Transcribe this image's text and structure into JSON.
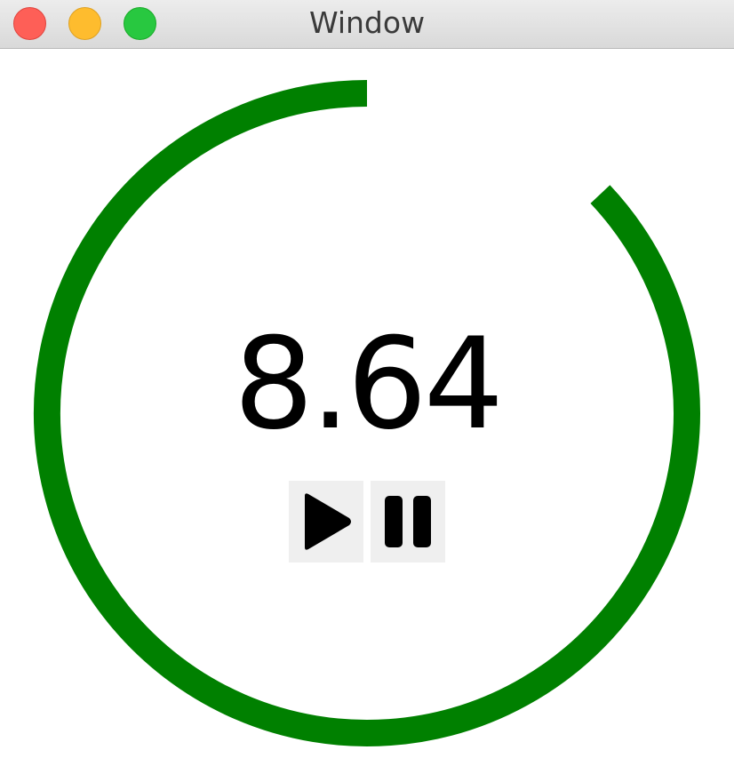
{
  "window": {
    "title": "Window"
  },
  "timer": {
    "value": "8.64",
    "progress_fraction": 0.87
  },
  "controls": {
    "play_icon": "play-icon",
    "pause_icon": "pause-icon"
  },
  "colors": {
    "ring": "#008000",
    "text": "#000000",
    "button_bg": "#efefef",
    "close": "#fe5f57",
    "minimize": "#febc2e",
    "zoom": "#28c840"
  }
}
